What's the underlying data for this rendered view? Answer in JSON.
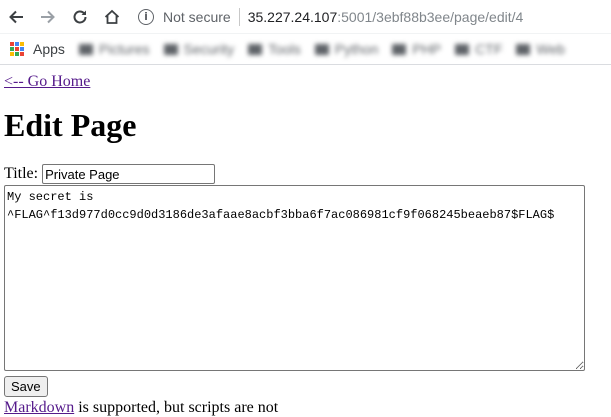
{
  "browser": {
    "security_label": "Not secure",
    "url_host": "35.227.24.107",
    "url_path": ":5001/3ebf88b3ee/page/edit/4",
    "bookmarks": {
      "apps_label": "Apps",
      "folders": [
        "Pictures",
        "Security",
        "Tools",
        "Python",
        "PHP",
        "CTF",
        "Web"
      ]
    }
  },
  "page": {
    "home_link": "<-- Go Home",
    "heading": "Edit Page",
    "title_label": "Title:",
    "title_value": "Private Page",
    "body_text": "My secret is\n^FLAG^f13d977d0cc9d0d3186de3afaae8acbf3bba6f7ac086981cf9f068245beaeb87$FLAG$",
    "save_label": "Save",
    "markdown_link": "Markdown",
    "markdown_note": " is supported, but scripts are not"
  }
}
